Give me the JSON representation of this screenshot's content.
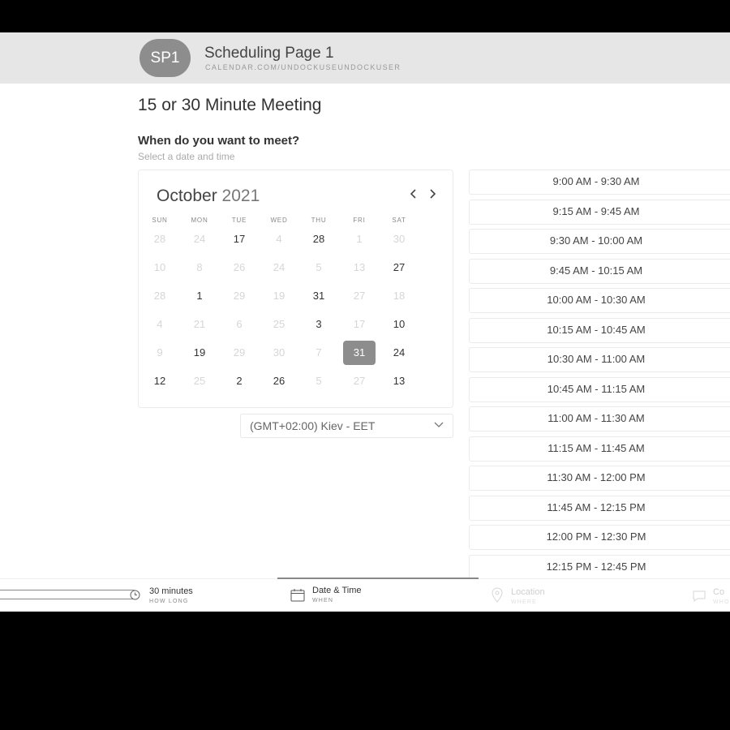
{
  "header": {
    "avatar_initials": "SP1",
    "page_name": "Scheduling Page 1",
    "page_url": "CALENDAR.COM/UNDOCKUSEUNDOCKUSER"
  },
  "meeting": {
    "title": "15 or 30 Minute Meeting",
    "question": "When do you want to meet?",
    "hint": "Select a date and time"
  },
  "calendar": {
    "month": "October",
    "year": "2021",
    "prev_icon": "chevron-left-icon",
    "next_icon": "chevron-right-icon",
    "weekdays": [
      "SUN",
      "MON",
      "TUE",
      "WED",
      "THU",
      "FRI",
      "SAT"
    ],
    "weeks": [
      [
        {
          "d": "28",
          "s": "muted"
        },
        {
          "d": "24",
          "s": "muted"
        },
        {
          "d": "17",
          "s": "active"
        },
        {
          "d": "4",
          "s": "muted"
        },
        {
          "d": "28",
          "s": "active"
        },
        {
          "d": "1",
          "s": "muted"
        },
        {
          "d": "30",
          "s": "muted"
        }
      ],
      [
        {
          "d": "10",
          "s": "muted"
        },
        {
          "d": "8",
          "s": "muted"
        },
        {
          "d": "26",
          "s": "muted"
        },
        {
          "d": "24",
          "s": "muted"
        },
        {
          "d": "5",
          "s": "muted"
        },
        {
          "d": "13",
          "s": "muted"
        },
        {
          "d": "27",
          "s": "active"
        }
      ],
      [
        {
          "d": "28",
          "s": "muted"
        },
        {
          "d": "1",
          "s": "active"
        },
        {
          "d": "29",
          "s": "muted"
        },
        {
          "d": "19",
          "s": "muted"
        },
        {
          "d": "31",
          "s": "active"
        },
        {
          "d": "27",
          "s": "muted"
        },
        {
          "d": "18",
          "s": "muted"
        }
      ],
      [
        {
          "d": "4",
          "s": "muted"
        },
        {
          "d": "21",
          "s": "muted"
        },
        {
          "d": "6",
          "s": "muted"
        },
        {
          "d": "25",
          "s": "muted"
        },
        {
          "d": "3",
          "s": "active"
        },
        {
          "d": "17",
          "s": "muted"
        },
        {
          "d": "10",
          "s": "active"
        }
      ],
      [
        {
          "d": "9",
          "s": "muted"
        },
        {
          "d": "19",
          "s": "active"
        },
        {
          "d": "29",
          "s": "muted"
        },
        {
          "d": "30",
          "s": "muted"
        },
        {
          "d": "7",
          "s": "muted"
        },
        {
          "d": "31",
          "s": "selected"
        },
        {
          "d": "24",
          "s": "active"
        }
      ],
      [
        {
          "d": "12",
          "s": "active"
        },
        {
          "d": "25",
          "s": "muted"
        },
        {
          "d": "2",
          "s": "active"
        },
        {
          "d": "26",
          "s": "active"
        },
        {
          "d": "5",
          "s": "muted"
        },
        {
          "d": "27",
          "s": "muted"
        },
        {
          "d": "13",
          "s": "active"
        }
      ]
    ]
  },
  "timezone": {
    "label": "(GMT+02:00) Kiev - EET",
    "icon": "chevron-down-icon"
  },
  "time_slots": [
    "9:00 AM - 9:30 AM",
    "9:15 AM - 9:45 AM",
    "9:30 AM - 10:00 AM",
    "9:45 AM - 10:15 AM",
    "10:00 AM - 10:30 AM",
    "10:15 AM - 10:45 AM",
    "10:30 AM - 11:00 AM",
    "10:45 AM - 11:15 AM",
    "11:00 AM - 11:30 AM",
    "11:15 AM - 11:45 AM",
    "11:30 AM - 12:00 PM",
    "11:45 AM - 12:15 PM",
    "12:00 PM - 12:30 PM",
    "12:15 PM - 12:45 PM"
  ],
  "footer": {
    "steps": [
      {
        "title": "30 minutes",
        "sub": "HOW LONG",
        "icon": "clock-icon",
        "state": "done"
      },
      {
        "title": "Date & Time",
        "sub": "WHEN",
        "icon": "calendar-icon",
        "state": "active"
      },
      {
        "title": "Location",
        "sub": "WHERE",
        "icon": "location-pin-icon",
        "state": "upcoming"
      },
      {
        "title": "Co",
        "sub": "WHO",
        "icon": "chat-icon",
        "state": "upcoming"
      }
    ]
  },
  "colors": {
    "header_bg": "#e6e6e6",
    "avatar_bg": "#8d8d8d",
    "selected_day_bg": "#8d8d8d"
  }
}
